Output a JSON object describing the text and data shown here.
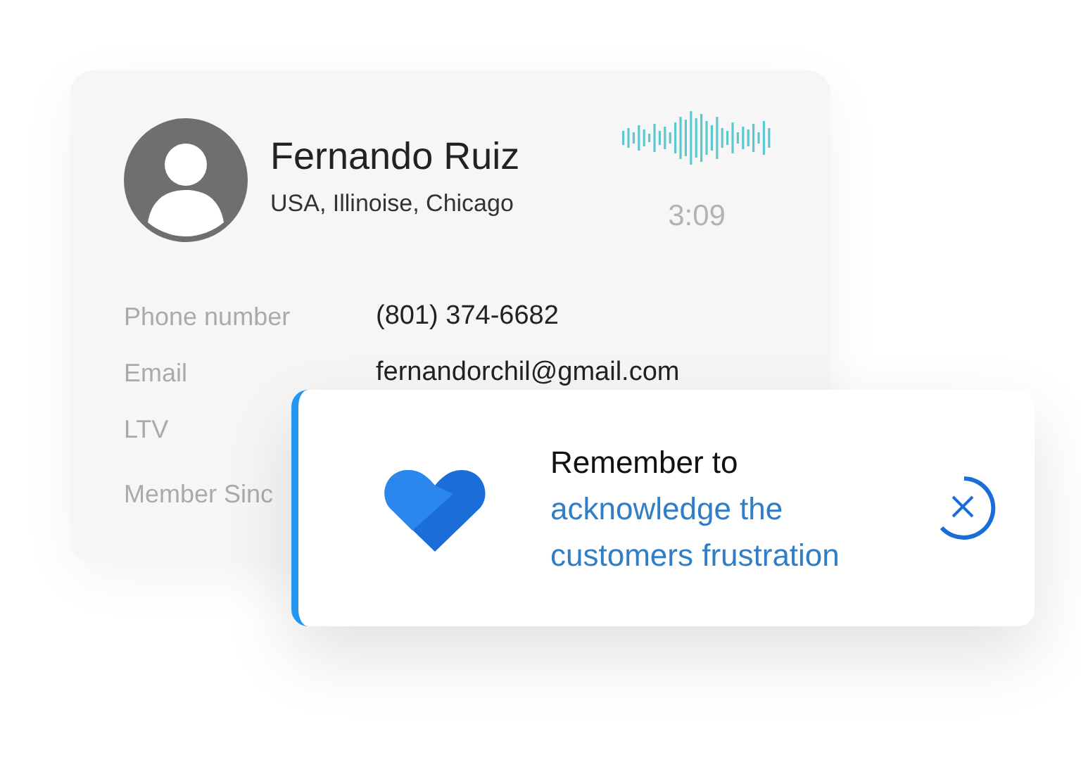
{
  "contact": {
    "name": "Fernando Ruiz",
    "location": "USA, Illinoise, Chicago",
    "call_duration": "3:09",
    "fields": [
      {
        "label": "Phone number",
        "value": "(801) 374-6682"
      },
      {
        "label": "Email",
        "value": "fernandorchil@gmail.com"
      },
      {
        "label": "LTV"
      },
      {
        "label": "Member Sinc"
      }
    ]
  },
  "toast": {
    "title": "Remember to",
    "message": "acknowledge the customers frustration"
  }
}
